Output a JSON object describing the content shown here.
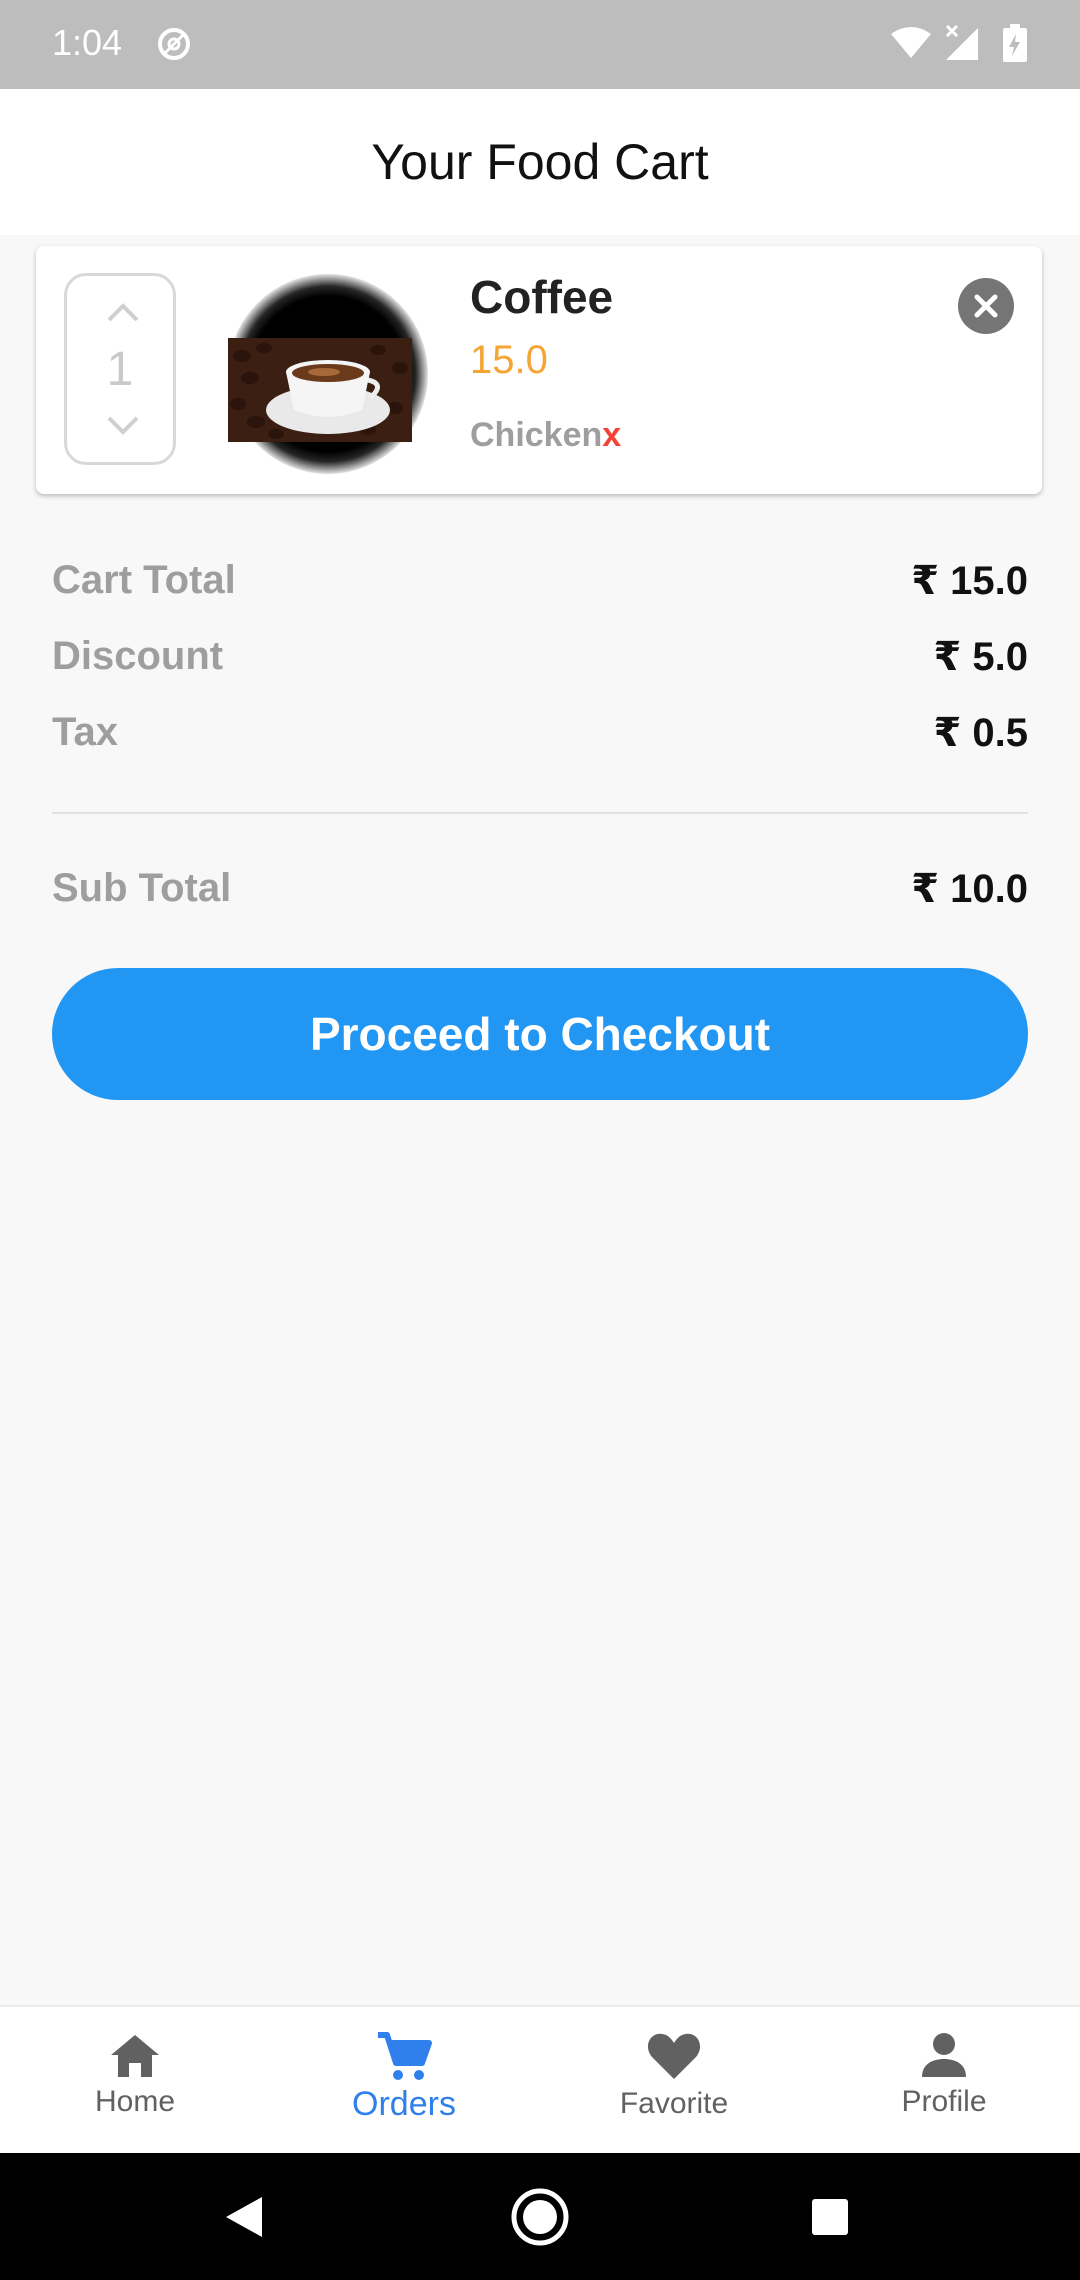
{
  "status_bar": {
    "time": "1:04"
  },
  "app_bar": {
    "title": "Your Food Cart"
  },
  "cart_items": [
    {
      "name": "Coffee",
      "price": "15.0",
      "variant": "Chicken",
      "variant_suffix": "x",
      "quantity": "1"
    }
  ],
  "summary": {
    "cart_total_label": "Cart Total",
    "cart_total_value": "₹ 15.0",
    "discount_label": "Discount",
    "discount_value": "₹ 5.0",
    "tax_label": "Tax",
    "tax_value": "₹ 0.5",
    "sub_total_label": "Sub Total",
    "sub_total_value": "₹ 10.0"
  },
  "checkout_button": {
    "label": "Proceed to Checkout"
  },
  "bottom_nav": {
    "items": [
      {
        "label": "Home",
        "icon": "home-icon",
        "active": false
      },
      {
        "label": "Orders",
        "icon": "cart-icon",
        "active": true
      },
      {
        "label": "Favorite",
        "icon": "heart-icon",
        "active": false
      },
      {
        "label": "Profile",
        "icon": "person-icon",
        "active": false
      }
    ]
  },
  "colors": {
    "accent": "#2196f3",
    "price": "#f4a535",
    "active_nav": "#2f80ed",
    "remove_x": "#f44336"
  }
}
